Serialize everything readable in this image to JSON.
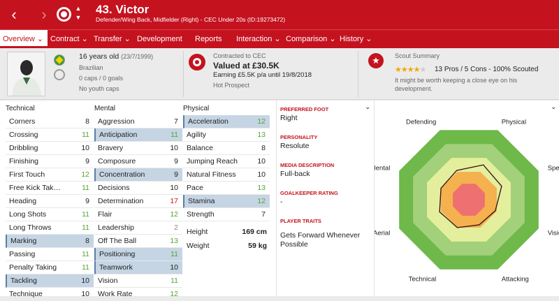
{
  "header": {
    "title": "43. Victor",
    "subtitle": "Defender/Wing Back, Midfielder (Right) - CEC Under 20s (ID:19273472)"
  },
  "tabs": [
    {
      "label": "Overview"
    },
    {
      "label": "Contract"
    },
    {
      "label": "Transfer"
    },
    {
      "label": "Development"
    },
    {
      "label": "Reports"
    },
    {
      "label": "Interaction"
    },
    {
      "label": "Comparison"
    },
    {
      "label": "History"
    }
  ],
  "profile": {
    "age": "16 years old",
    "dob": "(23/7/1999)",
    "nationality": "Brazilian",
    "caps": "0 caps / 0 goals",
    "youth_caps": "No youth caps"
  },
  "contract": {
    "heading": "Contracted to CEC",
    "value": "Valued at £30.5K",
    "earning": "Earning £5.5K p/a until 19/8/2018",
    "status": "Hot Prospect"
  },
  "scout": {
    "heading": "Scout Summary",
    "stars": 4,
    "stars_total": 5,
    "summary": "13 Pros / 5 Cons - 100% Scouted",
    "note1": "It might be worth keeping a close eye on his",
    "note2": "development."
  },
  "technical": {
    "heading": "Technical",
    "rows": [
      {
        "name": "Corners",
        "value": "8"
      },
      {
        "name": "Crossing",
        "value": "11"
      },
      {
        "name": "Dribbling",
        "value": "10"
      },
      {
        "name": "Finishing",
        "value": "9"
      },
      {
        "name": "First Touch",
        "value": "12"
      },
      {
        "name": "Free Kick Tak…",
        "value": "11"
      },
      {
        "name": "Heading",
        "value": "9"
      },
      {
        "name": "Long Shots",
        "value": "11"
      },
      {
        "name": "Long Throws",
        "value": "11"
      },
      {
        "name": "Marking",
        "value": "8"
      },
      {
        "name": "Passing",
        "value": "11"
      },
      {
        "name": "Penalty Taking",
        "value": "11"
      },
      {
        "name": "Tackling",
        "value": "10"
      },
      {
        "name": "Technique",
        "value": "10"
      }
    ]
  },
  "mental": {
    "heading": "Mental",
    "rows": [
      {
        "name": "Aggression",
        "value": "7"
      },
      {
        "name": "Anticipation",
        "value": "11"
      },
      {
        "name": "Bravery",
        "value": "10"
      },
      {
        "name": "Composure",
        "value": "9"
      },
      {
        "name": "Concentration",
        "value": "9"
      },
      {
        "name": "Decisions",
        "value": "10"
      },
      {
        "name": "Determination",
        "value": "17"
      },
      {
        "name": "Flair",
        "value": "12"
      },
      {
        "name": "Leadership",
        "value": "2"
      },
      {
        "name": "Off The Ball",
        "value": "13"
      },
      {
        "name": "Positioning",
        "value": "11"
      },
      {
        "name": "Teamwork",
        "value": "10"
      },
      {
        "name": "Vision",
        "value": "11"
      },
      {
        "name": "Work Rate",
        "value": "12"
      }
    ]
  },
  "physical": {
    "heading": "Physical",
    "rows": [
      {
        "name": "Acceleration",
        "value": "12"
      },
      {
        "name": "Agility",
        "value": "13"
      },
      {
        "name": "Balance",
        "value": "8"
      },
      {
        "name": "Jumping Reach",
        "value": "10"
      },
      {
        "name": "Natural Fitness",
        "value": "10"
      },
      {
        "name": "Pace",
        "value": "13"
      },
      {
        "name": "Stamina",
        "value": "12"
      },
      {
        "name": "Strength",
        "value": "7"
      }
    ],
    "height_label": "Height",
    "height": "169 cm",
    "weight_label": "Weight",
    "weight": "59 kg"
  },
  "info": {
    "foot_label": "PREFERRED FOOT",
    "foot": "Right",
    "personality_label": "PERSONALITY",
    "personality": "Resolute",
    "media_label": "MEDIA DESCRIPTION",
    "media": "Full-back",
    "gk_label": "GOALKEEPER RATING",
    "gk": "-",
    "traits_label": "PLAYER TRAITS",
    "trait1": "Gets Forward Whenever",
    "trait2": "Possible"
  },
  "radar": {
    "labels": [
      "Defending",
      "Physical",
      "Speed",
      "Vision",
      "Attacking",
      "Technical",
      "Aerial",
      "Mental"
    ],
    "values": [
      0.42,
      0.5,
      0.47,
      0.38,
      0.36,
      0.4,
      0.42,
      0.4
    ]
  },
  "colors": {
    "accent": "#c5121f",
    "highlight": "#c5d5e4",
    "good": "#52a532",
    "poor": "#d9151f"
  }
}
